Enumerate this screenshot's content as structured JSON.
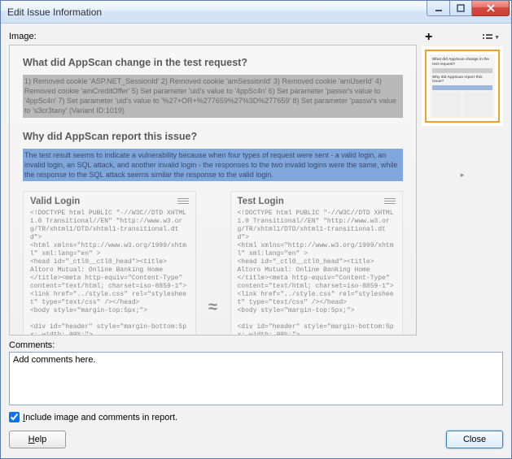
{
  "window": {
    "title": "Edit Issue Information"
  },
  "labels": {
    "image": "Image:",
    "comments": "Comments:",
    "include": "Include image and comments in report.",
    "include_mnemonic": "I",
    "help": "Help",
    "help_mnemonic": "H",
    "close": "Close"
  },
  "comments": {
    "value": "Add comments here."
  },
  "checkbox": {
    "checked": true
  },
  "report": {
    "q1": "What did AppScan change in the test request?",
    "a1": "1) Removed cookie 'ASP.NET_SessionId' 2) Removed cookie 'amSessionId' 3) Removed cookie 'amUserId' 4) Removed cookie 'amCreditOffer' 5) Set parameter 'uid's value to '4ppSc4n' 6) Set parameter 'passw's value to '4ppSc4n' 7) Set parameter 'uid's value to '%27+OR+%277659%27%3D%277659' 8) Set parameter 'passw's value to 's3cr3tany' (Variant ID:1019)",
    "q2": "Why did AppScan report this issue?",
    "a2": "The test result seems to indicate a vulnerability because when four types of request were sent - a valid login, an invalid login, an SQL attack, and another invalid login - the responses to the two invalid logins were the same, while the response to the SQL attack seems similar the response to the valid login.",
    "col1_title": "Valid Login",
    "col2_title": "Test Login",
    "code": "<!DOCTYPE html PUBLIC \"-//W3C//DTD XHTML 1.0 Transitional//EN\" \"http://www.w3.org/TR/xhtml1/DTD/xhtml1-transitional.dtd\">\n<html xmlns=\"http://www.w3.org/1999/xhtml\" xml:lang=\"en\" >\n<head id=\"_ctl0__ctl0_head\"><title>\nAltoro Mutual: Online Banking Home\n</title><meta http-equiv=\"Content-Type\" content=\"text/html; charset=iso-8859-1\"><link href=\"../style.css\" rel=\"stylesheet\" type=\"text/css\" /></head>\n<body style=\"margin-top:5px;\">\n\n<div id=\"header\" style=\"margin-bottom:5px; width: 99%;\">\n<form id=\"frmSearch\" method=\"get\" action=\"/search.aspx\">"
  },
  "thumb": {
    "line1": "What did AppScan change in the test request?",
    "line2": "Why did AppScan report this issue?"
  }
}
